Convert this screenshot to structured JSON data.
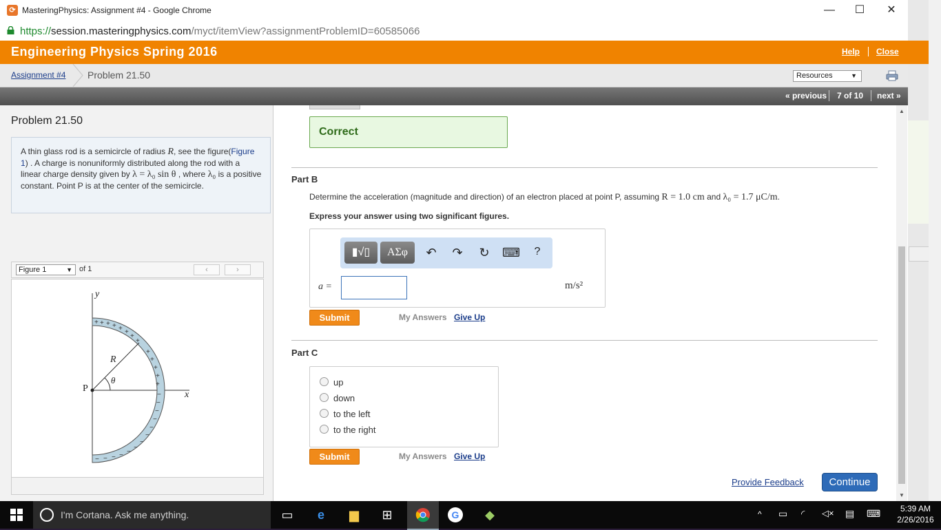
{
  "browser": {
    "window_title": "MasteringPhysics: Assignment #4 - Google Chrome",
    "url_scheme": "https://",
    "url_host": "session.masteringphysics.com",
    "url_path": "/myct/itemView?assignmentProblemID=60585066",
    "minimize": "—",
    "maximize": "☐",
    "close": "✕"
  },
  "header": {
    "course": "Engineering Physics Spring 2016",
    "help": "Help",
    "close": "Close"
  },
  "breadcrumb": {
    "assignment": "Assignment #4",
    "problem": "Problem 21.50",
    "resources": "Resources"
  },
  "nav": {
    "previous": "« previous",
    "position": "7 of 10",
    "next": "next »"
  },
  "problem": {
    "title": "Problem 21.50",
    "text_1": "A thin glass rod is a semicircle of radius",
    "R": "R",
    "text_2": ", see the figure(",
    "figure_link": "Figure 1",
    "text_3": ") . A charge is nonuniformly distributed along the rod with a linear charge density given by",
    "equation": "λ = λ₀ sin θ",
    "text_4": ", where",
    "lambda0": "λ₀",
    "text_5": "is a positive constant. Point P is at the center of the semicircle."
  },
  "figure": {
    "selector": "Figure 1",
    "of": "of 1",
    "prev": "‹",
    "next": "›",
    "label_y": "y",
    "label_x": "x",
    "label_R": "R",
    "label_theta": "θ",
    "label_P": "P",
    "rod_color": "#b9d3e0"
  },
  "partA": {
    "status": "Correct"
  },
  "partB": {
    "title": "Part B",
    "question_1": "Determine the acceleration (magnitude and direction) of an electron placed at point P, assuming",
    "cond_R": "R = 1.0 cm",
    "and": "and",
    "cond_lambda": "λ₀ = 1.7 μC/m",
    "period": ".",
    "instruction": "Express your answer using two significant figures.",
    "tool_templates": "▮√▯",
    "tool_greek": "ΑΣφ",
    "tool_undo": "↶",
    "tool_redo": "↷",
    "tool_reset": "↻",
    "tool_keyboard": "⌨",
    "tool_help": "?",
    "var_label": "a =",
    "input_value": "",
    "unit": "m/s²",
    "submit": "Submit",
    "my_answers": "My Answers",
    "give_up": "Give Up"
  },
  "partC": {
    "title": "Part C",
    "options": [
      "up",
      "down",
      "to the left",
      "to the right"
    ],
    "submit": "Submit",
    "my_answers": "My Answers",
    "give_up": "Give Up"
  },
  "footer": {
    "feedback": "Provide Feedback",
    "continue": "Continue"
  },
  "taskbar": {
    "cortana": "I'm Cortana. Ask me anything.",
    "time": "5:39 AM",
    "date": "2/26/2016"
  },
  "colors": {
    "orange": "#f08300",
    "link": "#1a3c8a",
    "correct_bg": "#e8f8e1",
    "continue": "#2e6bb8"
  }
}
